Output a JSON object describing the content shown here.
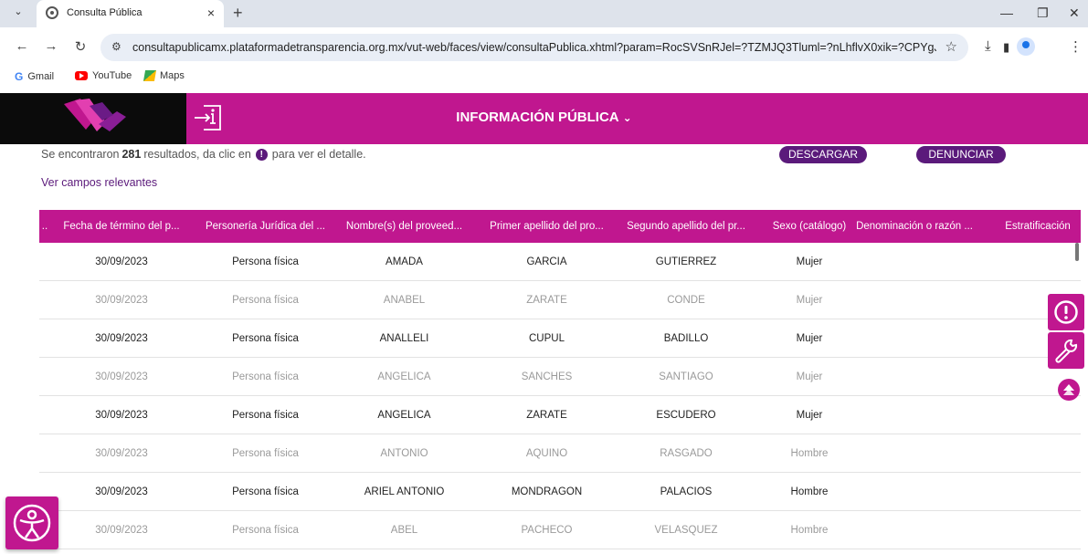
{
  "browser": {
    "tab_title": "Consulta Pública",
    "url": "consultapublicamx.plataformadetransparencia.org.mx/vut-web/faces/view/consultaPublica.xhtml?param=RocSVSnRJel=?TZMJQ3Tluml=?nLhflvX0xik=?CPYgJyqQH...",
    "bookmarks": [
      "Gmail",
      "YouTube",
      "Maps"
    ]
  },
  "header": {
    "title": "INFORMACIÓN PÚBLICA",
    "chevron": "⌄"
  },
  "results": {
    "prefix": "Se encontraron",
    "count": "281",
    "suffix_1": "resultados, da clic en",
    "suffix_2": "para ver el detalle.",
    "info_glyph": "!",
    "download_label": "DESCARGAR",
    "report_label": "DENUNCIAR",
    "relevant_link": "Ver campos relevantes"
  },
  "table": {
    "headers": [
      "..",
      "Fecha de término del p...",
      "Personería Jurídica del ...",
      "Nombre(s) del proveed...",
      "Primer apellido del pro...",
      "Segundo apellido del pr...",
      "Sexo (catálogo)",
      "Denominación o razón ...",
      "Estratificación"
    ],
    "rows": [
      [
        "30/09/2023",
        "Persona física",
        "AMADA",
        "GARCIA",
        "GUTIERREZ",
        "Mujer"
      ],
      [
        "30/09/2023",
        "Persona física",
        "ANABEL",
        "ZARATE",
        "CONDE",
        "Mujer"
      ],
      [
        "30/09/2023",
        "Persona física",
        "ANALLELI",
        "CUPUL",
        "BADILLO",
        "Mujer"
      ],
      [
        "30/09/2023",
        "Persona física",
        "ANGELICA",
        "SANCHES",
        "SANTIAGO",
        "Mujer"
      ],
      [
        "30/09/2023",
        "Persona física",
        "ANGELICA",
        "ZARATE",
        "ESCUDERO",
        "Mujer"
      ],
      [
        "30/09/2023",
        "Persona física",
        "ANTONIO",
        "AQUINO",
        "RASGADO",
        "Hombre"
      ],
      [
        "30/09/2023",
        "Persona física",
        "ARIEL ANTONIO",
        "MONDRAGON",
        "PALACIOS",
        "Hombre"
      ],
      [
        "30/09/2023",
        "Persona física",
        "ABEL",
        "PACHECO",
        "VELASQUEZ",
        "Hombre"
      ]
    ]
  },
  "icons": {
    "alert": "alert-icon",
    "tools": "wrench-icon",
    "scroll_up": "arrow-up-icon",
    "accessibility": "accessibility-icon"
  },
  "colors": {
    "brand_magenta": "#c0178f",
    "brand_purple": "#5b1a7b"
  }
}
